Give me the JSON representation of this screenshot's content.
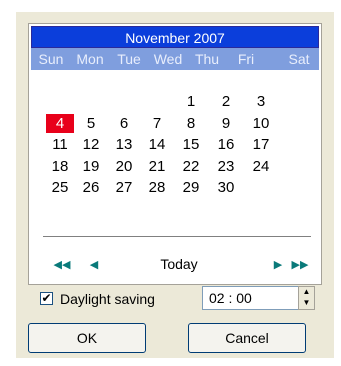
{
  "calendar": {
    "month_title": "November 2007",
    "weekdays": [
      "Sun",
      "Mon",
      "Tue",
      "Wed",
      "Thu",
      "Fri",
      "Sat"
    ],
    "selected_day": "4",
    "weeks": [
      [
        "",
        "",
        "",
        "",
        "1",
        "2",
        "3"
      ],
      [
        "4",
        "5",
        "6",
        "7",
        "8",
        "9",
        "10"
      ],
      [
        "11",
        "12",
        "13",
        "14",
        "15",
        "16",
        "17"
      ],
      [
        "18",
        "19",
        "20",
        "21",
        "22",
        "23",
        "24"
      ],
      [
        "25",
        "26",
        "27",
        "28",
        "29",
        "30",
        ""
      ]
    ],
    "nav": {
      "prev_year": "◀◀",
      "prev_month": "◀",
      "today_label": "Today",
      "next_month": "▶",
      "next_year": "▶▶"
    }
  },
  "footer": {
    "daylight_saving_label": "Daylight saving",
    "daylight_saving_checked": "✔",
    "time_value": "02 : 00",
    "ok_label": "OK",
    "cancel_label": "Cancel"
  },
  "colors": {
    "header_bg": "#0b3edb",
    "weekday_bg": "#7f9ede",
    "today_bg": "#e8001a",
    "nav_arrow": "#0a7a7a"
  }
}
